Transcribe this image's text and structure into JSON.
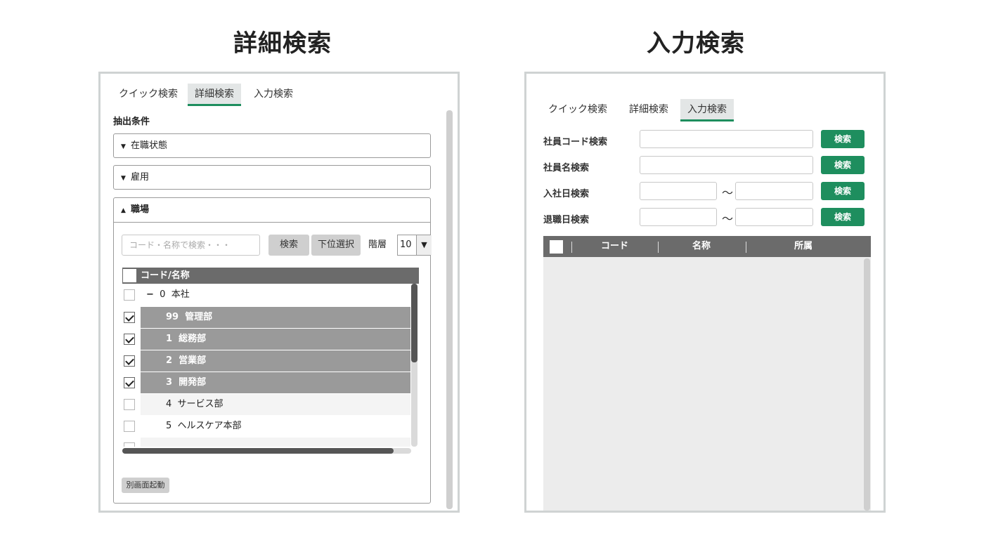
{
  "left": {
    "heading": "詳細検索",
    "tabs": [
      {
        "label": "クイック検索",
        "active": false
      },
      {
        "label": "詳細検索",
        "active": true
      },
      {
        "label": "入力検索",
        "active": false
      }
    ],
    "section_label": "抽出条件",
    "accordions": [
      {
        "label": "在職状態",
        "icon": "chevron-down-icon"
      },
      {
        "label": "雇用",
        "icon": "chevron-down-icon"
      },
      {
        "label": "職場",
        "icon": "chevron-up-icon"
      }
    ],
    "search_placeholder": "コード・名称で検索・・・",
    "search_button": "検索",
    "sub_select_button": "下位選択",
    "level_label": "階層",
    "level_value": "10",
    "table_header": "コード/名称",
    "tree_rows": [
      {
        "code": "0",
        "name": "本社",
        "checked": false,
        "expand": "−",
        "selected": false
      },
      {
        "code": "99",
        "name": "管理部",
        "checked": true,
        "expand": "",
        "selected": true
      },
      {
        "code": "1",
        "name": "総務部",
        "checked": true,
        "expand": "",
        "selected": true
      },
      {
        "code": "2",
        "name": "営業部",
        "checked": true,
        "expand": "",
        "selected": true
      },
      {
        "code": "3",
        "name": "開発部",
        "checked": true,
        "expand": "",
        "selected": true
      },
      {
        "code": "4",
        "name": "サービス部",
        "checked": false,
        "expand": "",
        "selected": false
      },
      {
        "code": "5",
        "name": "ヘルスケア本部",
        "checked": false,
        "expand": "",
        "selected": false
      }
    ],
    "popup_button": "別画面起動"
  },
  "right": {
    "heading": "入力検索",
    "tabs": [
      {
        "label": "クイック検索",
        "active": false
      },
      {
        "label": "詳細検索",
        "active": false
      },
      {
        "label": "入力検索",
        "active": true
      }
    ],
    "fields": [
      {
        "label": "社員コード検索",
        "range": false,
        "button": "検索"
      },
      {
        "label": "社員名検索",
        "range": false,
        "button": "検索"
      },
      {
        "label": "入社日検索",
        "range": true,
        "button": "検索"
      },
      {
        "label": "退職日検索",
        "range": true,
        "button": "検索"
      }
    ],
    "range_separator": "〜",
    "table_headers": [
      "コード",
      "名称",
      "所属"
    ]
  },
  "colors": {
    "accent": "#1e8e5e",
    "header_dark": "#6b6b6b",
    "selected_row": "#9a9a9a"
  }
}
